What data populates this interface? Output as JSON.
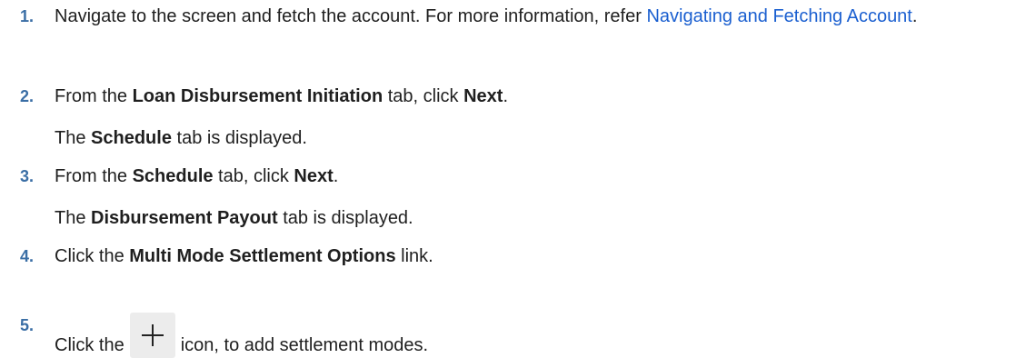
{
  "steps": [
    {
      "number": "1.",
      "pre": "Navigate to the screen and fetch the account. For more information, refer ",
      "link": "Navigating and Fetching Account",
      "post": "."
    },
    {
      "number": "2.",
      "t1": "From the ",
      "b1": "Loan Disbursement Initiation",
      "t2": " tab, click ",
      "b2": "Next",
      "t3": ".",
      "note": {
        "t1": "The ",
        "b1": "Schedule",
        "t2": " tab is displayed."
      }
    },
    {
      "number": "3.",
      "t1": "From the ",
      "b1": "Schedule",
      "t2": " tab, click ",
      "b2": "Next",
      "t3": ".",
      "note": {
        "t1": "The ",
        "b1": "Disbursement Payout",
        "t2": " tab is displayed."
      }
    },
    {
      "number": "4.",
      "t1": "Click the ",
      "b1": "Multi Mode Settlement Options",
      "t2": " link."
    },
    {
      "number": "5.",
      "t1": "Click the",
      "icon": "plus-icon",
      "t2": "icon, to add settlement modes."
    }
  ]
}
